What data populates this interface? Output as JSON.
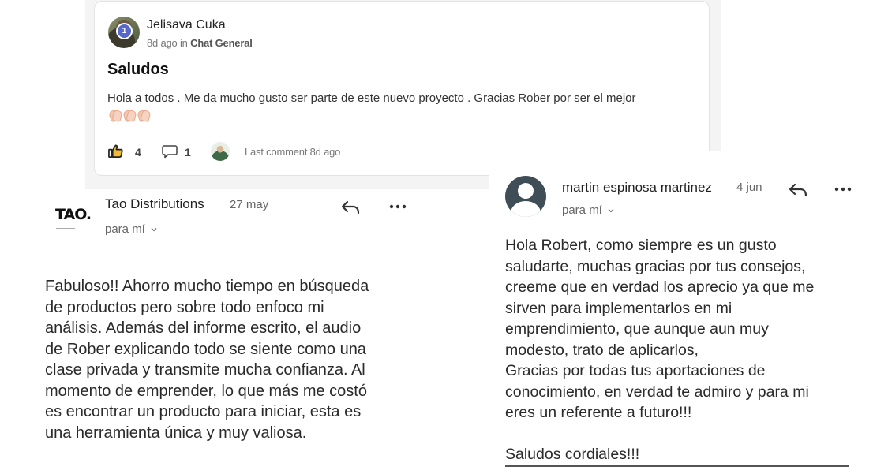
{
  "post": {
    "author": "Jelisava Cuka",
    "level": "1",
    "time": "8d ago in",
    "channel": "Chat General",
    "title": "Saludos",
    "body": "Hola a todos . Me da mucho gusto ser parte de este nuevo proyecto . Gracias Rober por ser el mejor",
    "emoji": [
      "clapping-hands",
      "clapping-hands",
      "clapping-hands"
    ],
    "likes": "4",
    "comments": "1",
    "last_comment": "Last comment 8d ago"
  },
  "email1": {
    "logo_text": "TAO.",
    "sender": "Tao Distributions",
    "date": "27 may",
    "recipient": "para mí",
    "body": [
      "Fabuloso!! Ahorro mucho tiempo en búsqueda",
      "de productos pero sobre todo enfoco mi",
      "análisis. Además del informe escrito, el audio",
      "de Rober explicando todo se siente como una",
      "clase privada y transmite mucha confianza. Al",
      "momento de emprender, lo que más me costó",
      "es encontrar un producto para iniciar, esta es",
      "una herramienta única y muy valiosa."
    ]
  },
  "email2": {
    "sender": "martin espinosa martinez",
    "date": "4 jun",
    "recipient": "para mí",
    "body": [
      "Hola Robert, como siempre es un gusto",
      "saludarte, muchas gracias por tus consejos,",
      "creeme que en verdad los aprecio ya que me",
      "sirven para implementarlos en mi",
      "emprendimiento, que aunque aun muy",
      "modesto, trato de aplicarlos,",
      "Gracias por todas tus aportaciones de",
      "conocimiento, en verdad te admiro y para mi",
      "eres un referente a futuro!!!",
      "",
      "Saludos cordiales!!!"
    ]
  },
  "icons": {
    "like": "thumbs-up-icon",
    "comment": "comment-bubble-icon",
    "reply": "reply-arrow-icon",
    "more": "more-horizontal-icon",
    "dropdown": "chevron-down-icon"
  },
  "colors": {
    "badge": "#5668c9",
    "card_bg": "#ffffff",
    "backdrop": "#f4f4f5",
    "generic_avatar": "#3f4d57"
  }
}
